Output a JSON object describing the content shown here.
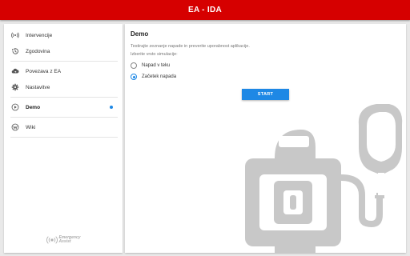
{
  "app": {
    "title": "EA - IDA"
  },
  "sidebar": {
    "items": [
      {
        "label": "Intervencije",
        "icon": "broadcast-icon"
      },
      {
        "label": "Zgodovina",
        "icon": "history-icon"
      },
      {
        "label": "Povezava z EA",
        "icon": "cloud-sync-icon"
      },
      {
        "label": "Nastavitve",
        "icon": "gear-icon"
      },
      {
        "label": "Demo",
        "icon": "play-circle-icon",
        "active": true
      },
      {
        "label": "Wiki",
        "icon": "wiki-icon"
      }
    ],
    "brand": {
      "line1": "Emergency",
      "line2": "Assist"
    }
  },
  "main": {
    "title": "Demo",
    "description": "Testirajte zeznanje napade in preverite uporabnost aplikacije.",
    "prompt": "Izberite vrsto simulacije:",
    "options": [
      {
        "label": "Napad v teku",
        "selected": false
      },
      {
        "label": "Začetek napada",
        "selected": true
      }
    ],
    "start_label": "START"
  },
  "colors": {
    "appbar": "#d60000",
    "accent": "#1e88e5",
    "illustration": "#c8c8c8"
  }
}
